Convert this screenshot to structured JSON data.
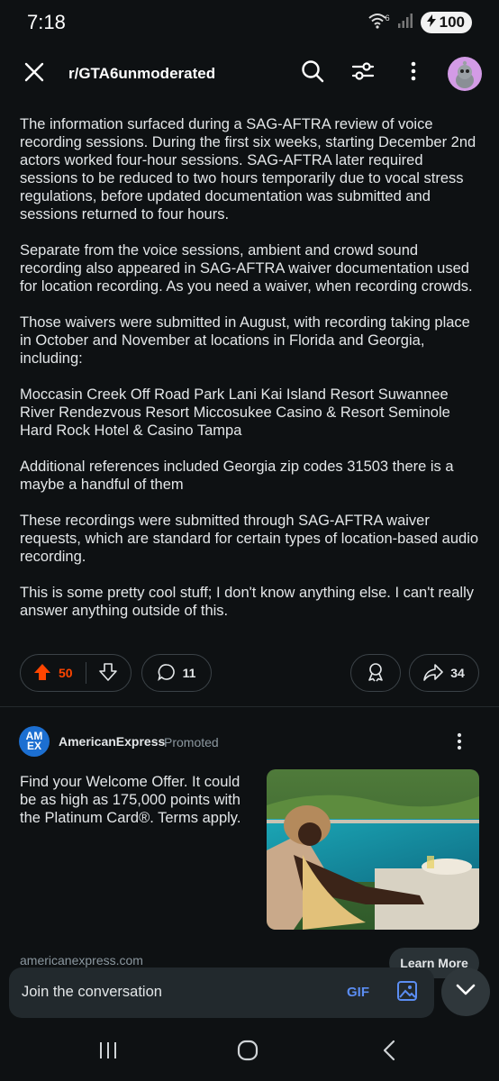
{
  "status_bar": {
    "time": "7:18",
    "wifi_label": "6",
    "battery": "100"
  },
  "header": {
    "title": "r/GTA6unmoderated",
    "icons": [
      "close-icon",
      "search-icon",
      "filter-icon",
      "more-icon",
      "avatar"
    ]
  },
  "post": {
    "paragraphs": [
      "The information surfaced during a SAG-AFTRA review of voice recording sessions. During the first six weeks, starting December 2nd actors worked four-hour sessions. SAG-AFTRA later required sessions to be reduced to two hours temporarily due to vocal stress regulations, before updated documentation was submitted and sessions returned to four hours.",
      "Separate from the voice sessions, ambient and crowd sound recording also appeared in SAG-AFTRA waiver documentation used for location recording. As you need a waiver, when recording crowds.",
      "Those waivers were submitted in August, with recording taking place in October and November at locations in Florida and Georgia, including:",
      "Moccasin Creek Off Road Park Lani Kai Island Resort Suwannee River Rendezvous Resort Miccosukee Casino & Resort Seminole Hard Rock Hotel & Casino Tampa",
      "Additional references included Georgia zip codes 31503 there is a maybe a handful of them",
      "These recordings were submitted through SAG-AFTRA waiver requests, which are standard for certain types of location-based audio recording.",
      "This is some pretty cool stuff; I don't know anything else. I can't really answer anything outside of this."
    ],
    "actions": {
      "upvotes": "50",
      "comments": "11",
      "shares": "34"
    }
  },
  "ad": {
    "advertiser": "AmericanExpress",
    "promoted_label": "Promoted",
    "logo_text": "AM EX",
    "text": "Find your Welcome Offer. It could be as high as 175,000 points with the Platinum Card®. Terms apply.",
    "domain": "americanexpress.com",
    "cta": "Learn More"
  },
  "reply": {
    "placeholder": "Join the conversation",
    "gif_label": "GIF"
  },
  "colors": {
    "background": "#0e1113",
    "upvote": "#ff4500",
    "gif": "#5b8df2",
    "avatar": "#d39be6"
  }
}
